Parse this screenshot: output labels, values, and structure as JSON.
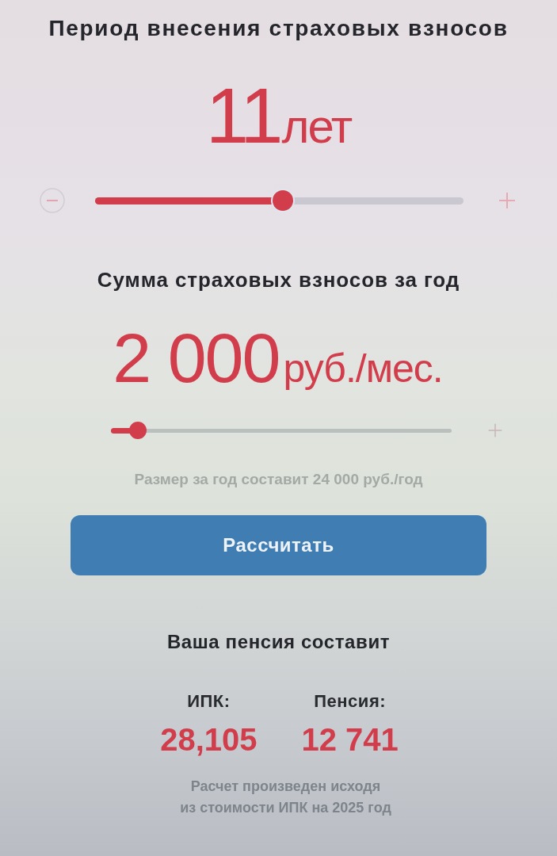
{
  "period": {
    "title": "Период внесения страховых взносов",
    "value": "11",
    "unit": "лет",
    "slider": {
      "level": 0.51,
      "minus_button": true,
      "plus_button": true
    }
  },
  "contribution": {
    "title": "Сумма страховых взносов за год",
    "value": "2 000",
    "unit": "руб./мес.",
    "slider": {
      "level": 0.08,
      "plus_button": true
    },
    "note": "Размер за год составит 24 000 руб./год"
  },
  "calculate_button": "Рассчитать",
  "result": {
    "title": "Ваша пенсия составит",
    "items": [
      {
        "label": "ИПК:",
        "value": "28,105"
      },
      {
        "label": "Пенсия:",
        "value": "12 741"
      }
    ],
    "footnote": "Расчет произведен исходя\nиз стоимости ИПК на 2025 год"
  }
}
